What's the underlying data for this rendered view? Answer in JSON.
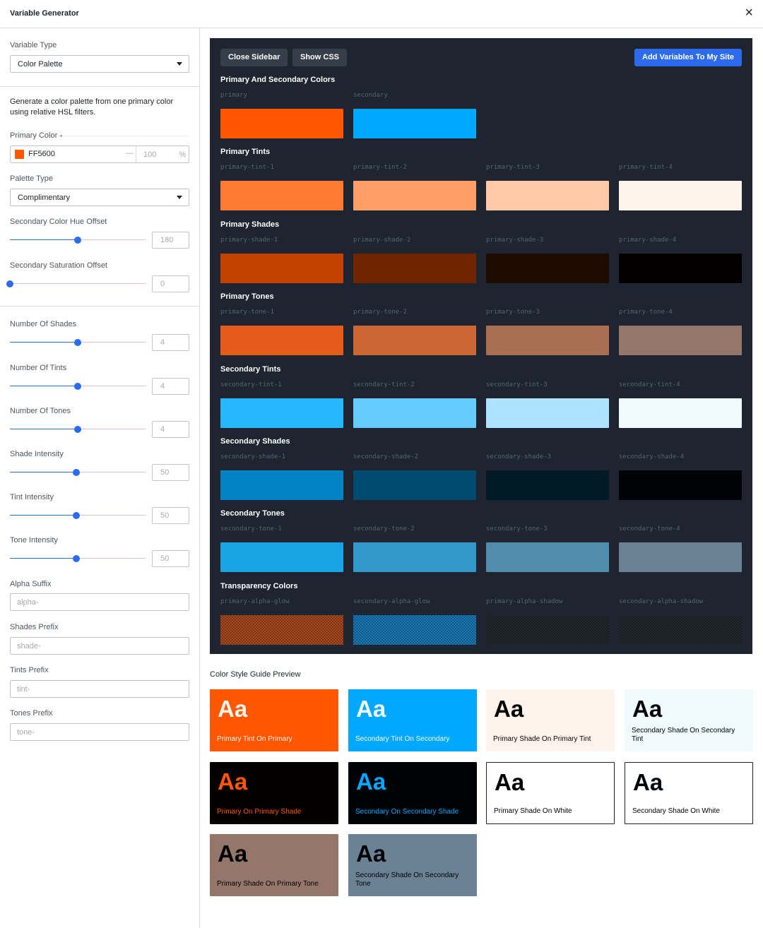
{
  "header": {
    "title": "Variable Generator",
    "close_icon": "×"
  },
  "sidebar": {
    "variable_type_label": "Variable Type",
    "variable_type_value": "Color Palette",
    "description": "Generate a color palette from one primary color using relative HSL filters.",
    "primary_color_label": "Primary Color",
    "required_mark": "•",
    "primary_color_hex": "FF5600",
    "primary_color_swatch": "#FF5600",
    "alpha_dash": "—",
    "alpha_value": "100",
    "alpha_unit": "%",
    "palette_type_label": "Palette Type",
    "palette_type_value": "Complimentary",
    "hue_offset_label": "Secondary Color Hue Offset",
    "hue_offset_value": "180",
    "hue_offset_level": 0.5,
    "saturation_offset_label": "Secondary Saturation Offset",
    "saturation_offset_value": "0",
    "saturation_offset_level": 0.0,
    "shades_label": "Number Of Shades",
    "shades_value": "4",
    "shades_level": 0.5,
    "tints_label": "Number Of Tints",
    "tints_value": "4",
    "tints_level": 0.5,
    "tones_label": "Number Of Tones",
    "tones_value": "4",
    "tones_level": 0.5,
    "shade_intensity_label": "Shade Intensity",
    "shade_intensity_value": "50",
    "shade_intensity_level": 0.49,
    "tint_intensity_label": "Tint Intensity",
    "tint_intensity_value": "50",
    "tint_intensity_level": 0.49,
    "tone_intensity_label": "Tone Intensity",
    "tone_intensity_value": "50",
    "tone_intensity_level": 0.49,
    "alpha_suffix_label": "Alpha Suffix",
    "alpha_suffix_placeholder": "alpha-",
    "shades_prefix_label": "Shades Prefix",
    "shades_prefix_placeholder": "shade-",
    "tints_prefix_label": "Tints Prefix",
    "tints_prefix_placeholder": "tint-",
    "tones_prefix_label": "Tones Prefix",
    "tones_prefix_placeholder": "tone-"
  },
  "toolbar": {
    "close_sidebar": "Close Sidebar",
    "show_css": "Show CSS",
    "add_variables": "Add Variables To My Site"
  },
  "groups": [
    {
      "title": "Primary And Secondary Colors",
      "swatches": [
        {
          "name": "primary",
          "color": "#FF5600"
        },
        {
          "name": "secondary",
          "color": "#00A9FF"
        }
      ]
    },
    {
      "title": "Primary Tints",
      "swatches": [
        {
          "name": "primary-tint-1",
          "color": "#FF7A33"
        },
        {
          "name": "primary-tint-2",
          "color": "#FF9E66"
        },
        {
          "name": "primary-tint-3",
          "color": "#FFC9A8"
        },
        {
          "name": "primary-tint-4",
          "color": "#FFF3EB"
        }
      ]
    },
    {
      "title": "Primary Shades",
      "swatches": [
        {
          "name": "primary-shade-1",
          "color": "#C44200"
        },
        {
          "name": "primary-shade-2",
          "color": "#6E2500"
        },
        {
          "name": "primary-shade-3",
          "color": "#1F0A00"
        },
        {
          "name": "primary-shade-4",
          "color": "#030100"
        }
      ]
    },
    {
      "title": "Primary Tones",
      "swatches": [
        {
          "name": "primary-tone-1",
          "color": "#E55C1A"
        },
        {
          "name": "primary-tone-2",
          "color": "#CC6633"
        },
        {
          "name": "primary-tone-3",
          "color": "#A86F50"
        },
        {
          "name": "primary-tone-4",
          "color": "#94776A"
        }
      ]
    },
    {
      "title": "Secondary Tints",
      "swatches": [
        {
          "name": "secondary-tint-1",
          "color": "#26B7FF"
        },
        {
          "name": "secondary-tint-2",
          "color": "#66CCFF"
        },
        {
          "name": "secondary-tint-3",
          "color": "#ADE3FF"
        },
        {
          "name": "secondary-tint-4",
          "color": "#F0FAFF"
        }
      ]
    },
    {
      "title": "Secondary Shades",
      "swatches": [
        {
          "name": "secondary-shade-1",
          "color": "#0082C4"
        },
        {
          "name": "secondary-shade-2",
          "color": "#004A70"
        },
        {
          "name": "secondary-shade-3",
          "color": "#001A26"
        },
        {
          "name": "secondary-shade-4",
          "color": "#000305"
        }
      ]
    },
    {
      "title": "Secondary Tones",
      "swatches": [
        {
          "name": "secondary-tone-1",
          "color": "#1AA4E5"
        },
        {
          "name": "secondary-tone-2",
          "color": "#3399CC"
        },
        {
          "name": "secondary-tone-3",
          "color": "#508DAD"
        },
        {
          "name": "secondary-tone-4",
          "color": "#6A8294"
        }
      ]
    },
    {
      "title": "Transparency Colors",
      "swatches": [
        {
          "name": "primary-alpha-glow",
          "color": "#A8481D",
          "pattern": true
        },
        {
          "name": "secondary-alpha-glow",
          "color": "#1A78B8",
          "pattern": true
        },
        {
          "name": "primary-alpha-shadow",
          "color": "#23272E",
          "pattern": true
        },
        {
          "name": "secondary-alpha-shadow",
          "color": "#23272E",
          "pattern": true
        }
      ]
    }
  ],
  "guide": {
    "title": "Color Style Guide Preview",
    "sample": "Aa",
    "cards": [
      {
        "label": "Primary Tint On Primary",
        "bg": "#FF5600",
        "fg": "#FFF3EB",
        "border": ""
      },
      {
        "label": "Secondary Tint On Secondary",
        "bg": "#00A9FF",
        "fg": "#F0FAFF",
        "border": ""
      },
      {
        "label": "Primary Shade On Primary Tint",
        "bg": "#FFF3EB",
        "fg": "#030100",
        "border": ""
      },
      {
        "label": "Secondary Shade On Secondary Tint",
        "bg": "#F0FAFF",
        "fg": "#000305",
        "border": ""
      },
      {
        "label": "Primary On Primary Shade",
        "bg": "#030100",
        "fg": "#FF5600",
        "border": ""
      },
      {
        "label": "Secondary On Secondary Shade",
        "bg": "#000305",
        "fg": "#00A9FF",
        "border": ""
      },
      {
        "label": "Primary Shade On White",
        "bg": "#FFFFFF",
        "fg": "#030100",
        "border": "#1d2327"
      },
      {
        "label": "Secondary Shade On White",
        "bg": "#FFFFFF",
        "fg": "#000305",
        "border": "#1d2327"
      },
      {
        "label": "Primary Shade On Primary Tone",
        "bg": "#94776A",
        "fg": "#030100",
        "border": ""
      },
      {
        "label": "Secondary Shade On Secondary Tone",
        "bg": "#6A8294",
        "fg": "#000305",
        "border": ""
      }
    ]
  }
}
